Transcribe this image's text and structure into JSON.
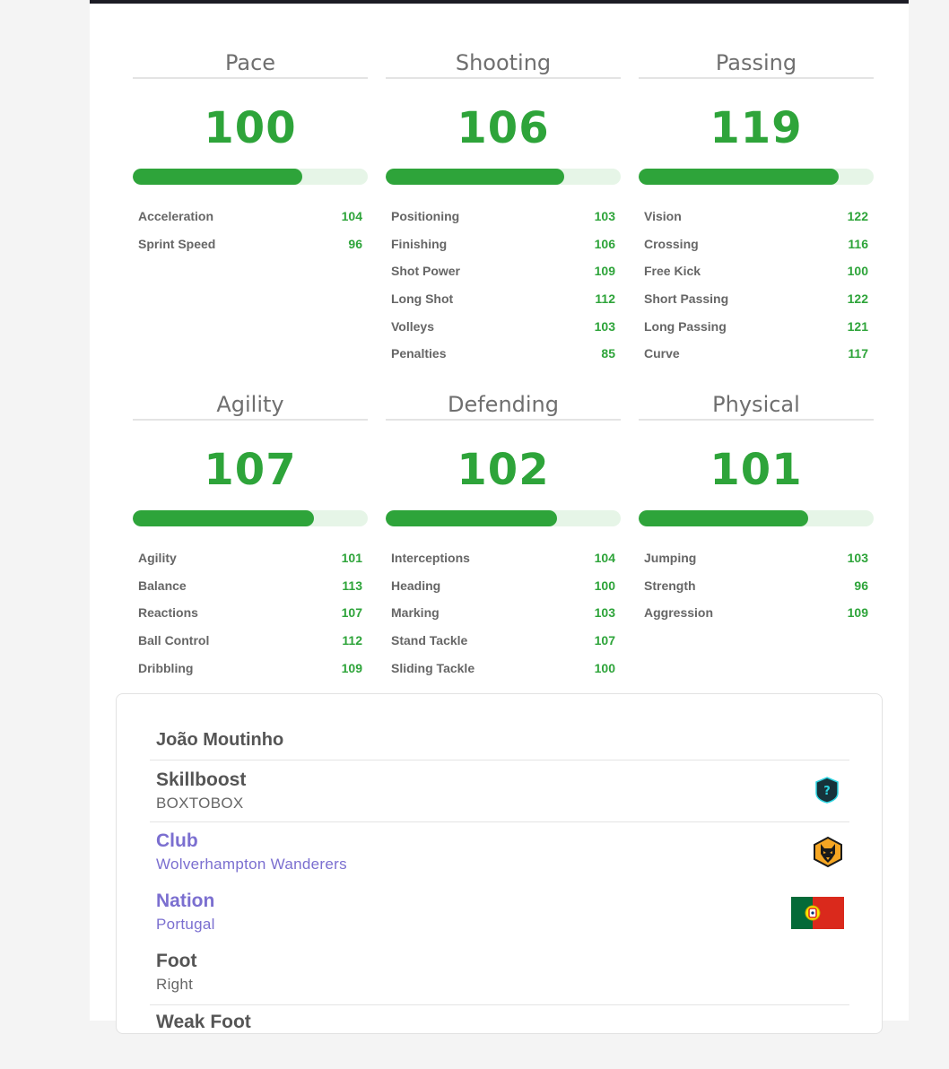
{
  "stats": [
    {
      "title": "Pace",
      "value": "100",
      "fill": 0.72,
      "attributes": [
        {
          "label": "Acceleration",
          "value": "104"
        },
        {
          "label": "Sprint Speed",
          "value": "96"
        }
      ]
    },
    {
      "title": "Shooting",
      "value": "106",
      "fill": 0.76,
      "attributes": [
        {
          "label": "Positioning",
          "value": "103"
        },
        {
          "label": "Finishing",
          "value": "106"
        },
        {
          "label": "Shot Power",
          "value": "109"
        },
        {
          "label": "Long Shot",
          "value": "112"
        },
        {
          "label": "Volleys",
          "value": "103"
        },
        {
          "label": "Penalties",
          "value": "85"
        }
      ]
    },
    {
      "title": "Passing",
      "value": "119",
      "fill": 0.85,
      "attributes": [
        {
          "label": "Vision",
          "value": "122"
        },
        {
          "label": "Crossing",
          "value": "116"
        },
        {
          "label": "Free Kick",
          "value": "100"
        },
        {
          "label": "Short Passing",
          "value": "122"
        },
        {
          "label": "Long Passing",
          "value": "121"
        },
        {
          "label": "Curve",
          "value": "117"
        }
      ]
    },
    {
      "title": "Agility",
      "value": "107",
      "fill": 0.77,
      "attributes": [
        {
          "label": "Agility",
          "value": "101"
        },
        {
          "label": "Balance",
          "value": "113"
        },
        {
          "label": "Reactions",
          "value": "107"
        },
        {
          "label": "Ball Control",
          "value": "112"
        },
        {
          "label": "Dribbling",
          "value": "109"
        }
      ]
    },
    {
      "title": "Defending",
      "value": "102",
      "fill": 0.73,
      "attributes": [
        {
          "label": "Interceptions",
          "value": "104"
        },
        {
          "label": "Heading",
          "value": "100"
        },
        {
          "label": "Marking",
          "value": "103"
        },
        {
          "label": "Stand Tackle",
          "value": "107"
        },
        {
          "label": "Sliding Tackle",
          "value": "100"
        }
      ]
    },
    {
      "title": "Physical",
      "value": "101",
      "fill": 0.72,
      "attributes": [
        {
          "label": "Jumping",
          "value": "103"
        },
        {
          "label": "Strength",
          "value": "96"
        },
        {
          "label": "Aggression",
          "value": "109"
        }
      ]
    }
  ],
  "player": {
    "name": "João Moutinho",
    "skillboost_label": "Skillboost",
    "skillboost_value": "BOXTOBOX",
    "club_label": "Club",
    "club_value": "Wolverhampton Wanderers",
    "nation_label": "Nation",
    "nation_value": "Portugal",
    "foot_label": "Foot",
    "foot_value": "Right",
    "weak_foot_label": "Weak Foot"
  },
  "icons": {
    "skillboost": "question-shield-icon",
    "club": "wolves-crest-icon",
    "nation": "portugal-flag-icon"
  },
  "colors": {
    "accent_green": "#2ea43a",
    "bar_track": "#e6f5e7",
    "link_purple": "#7b6fd0"
  }
}
